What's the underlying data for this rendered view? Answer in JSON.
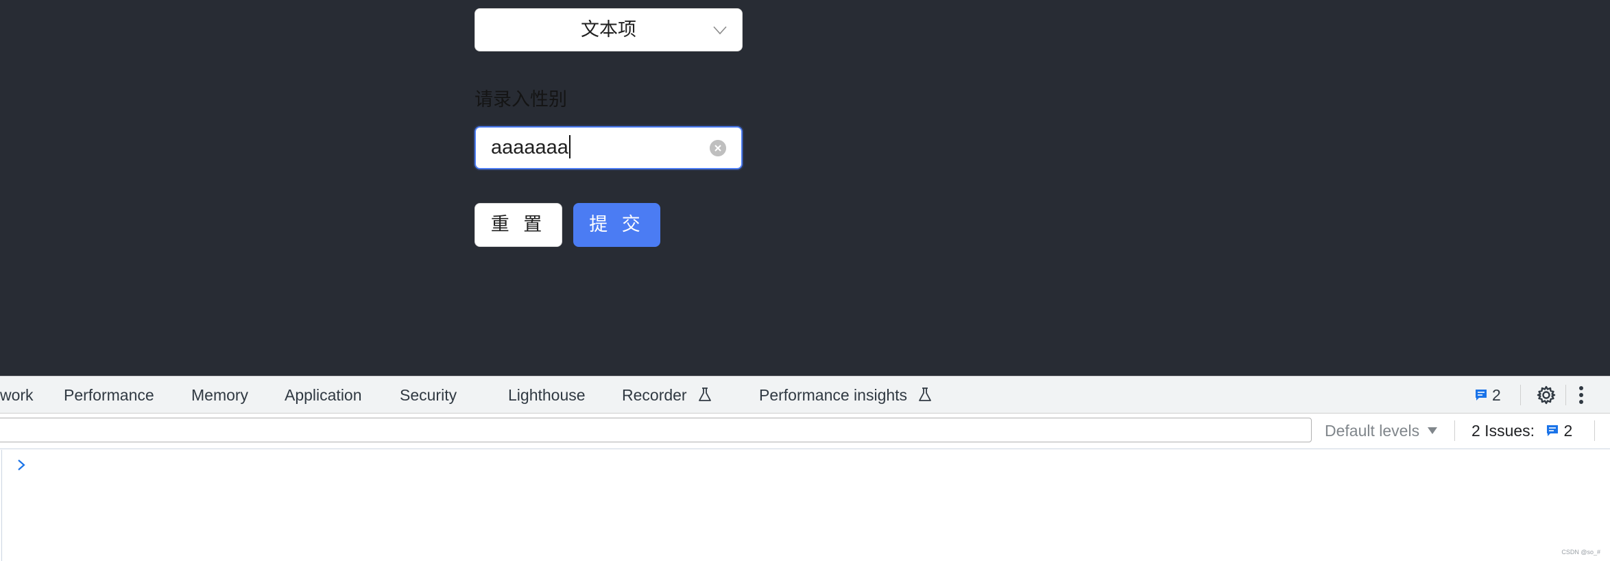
{
  "form": {
    "select_value": "文本项",
    "field_label": "请录入性别",
    "input_value": "aaaaaaa",
    "reset_label": "重 置",
    "submit_label": "提 交"
  },
  "devtools": {
    "tabs": [
      "work",
      "Performance",
      "Memory",
      "Application",
      "Security",
      "Lighthouse",
      "Recorder",
      "Performance insights"
    ],
    "issues_badge_count": "2",
    "default_levels_label": "Default levels",
    "issues_summary_label": "2 Issues:",
    "issues_summary_count": "2"
  },
  "watermark": "CSDN @so_#",
  "colors": {
    "app_background": "#282c34",
    "primary": "#4b7cf3",
    "devtools_tabbar": "#f1f3f4",
    "issue_icon": "#1a73e8"
  },
  "icons": {
    "select_arrow": "chevron-down-icon",
    "clear": "close-circle-icon",
    "experiment": "flask-icon",
    "issues": "message-icon",
    "settings": "gear-icon",
    "more": "kebab-menu-icon",
    "prompt": "chevron-right-icon"
  }
}
